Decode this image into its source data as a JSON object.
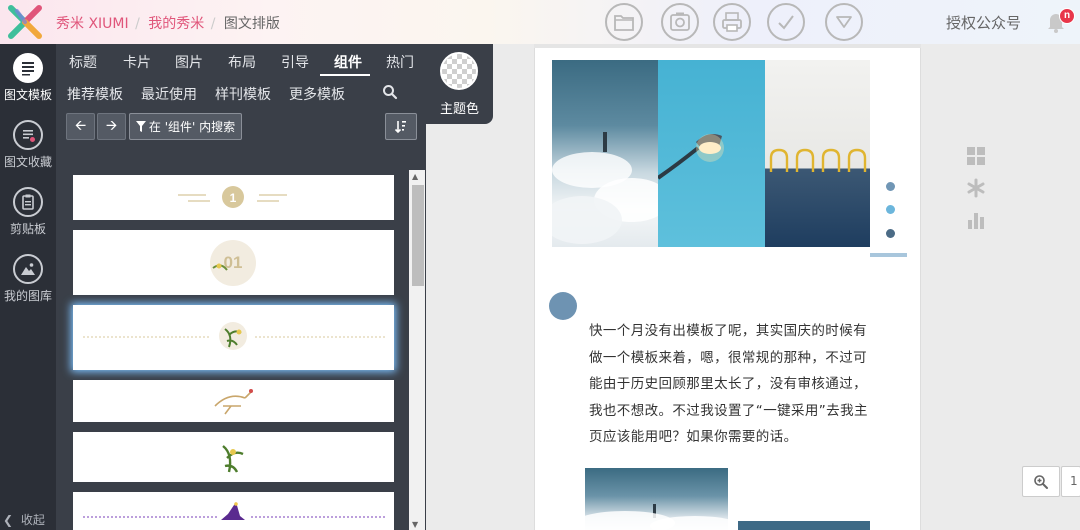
{
  "breadcrumb": {
    "site": "秀米 XIUMI",
    "mine": "我的秀米",
    "current": "图文排版",
    "sep": "/"
  },
  "header": {
    "authorize_label": "授权公众号",
    "notification_badge": "n",
    "toolbar_icons": [
      "folder-icon",
      "camera-icon",
      "printer-icon",
      "check-icon",
      "dropdown-triangle-icon"
    ]
  },
  "rail": {
    "items": [
      {
        "label": "图文模板",
        "icon": "template-list-icon",
        "active": true
      },
      {
        "label": "图文收藏",
        "icon": "favorites-icon",
        "active": false
      },
      {
        "label": "剪贴板",
        "icon": "clipboard-icon",
        "active": false
      },
      {
        "label": "我的图库",
        "icon": "gallery-icon",
        "active": false
      }
    ],
    "collapse_label": "收起"
  },
  "panel": {
    "tabs": [
      "标题",
      "卡片",
      "图片",
      "布局",
      "引导",
      "组件",
      "热门"
    ],
    "active_tab": "组件",
    "subtabs": [
      "推荐模板",
      "最近使用",
      "样刊模板",
      "更多模板"
    ],
    "filter_label": "在 '组件' 内搜索",
    "theme_label": "主题色"
  },
  "templates": [
    {
      "name": "divider-badge-1",
      "badge": "1"
    },
    {
      "name": "badge-01",
      "badge": "01"
    },
    {
      "name": "leaf-divider",
      "badge": ""
    },
    {
      "name": "crane-ornament",
      "badge": ""
    },
    {
      "name": "leaf-ornament",
      "badge": ""
    },
    {
      "name": "witch-hat-divider",
      "badge": ""
    }
  ],
  "document": {
    "paragraph": "快一个月没有出模板了呢，其实国庆的时候有做一个模板来着，嗯，很常规的那种，不过可能由于历史回顾那里太长了，没有审核通过，我也不想改。不过我设置了“一键采用”去我主页应该能用吧？如果你需要的话。",
    "dot_colors": [
      "#7096b5",
      "#6cb6dc",
      "#4b6b86"
    ]
  },
  "colors": {
    "brand_pink": "#e0557a",
    "panel_bg": "#3a3f48",
    "rail_bg": "#2b2f37",
    "accent_blue": "#6e93b2"
  },
  "zoom": {
    "zoom_in_icon": "zoom-in-icon",
    "partial_value": "1"
  }
}
